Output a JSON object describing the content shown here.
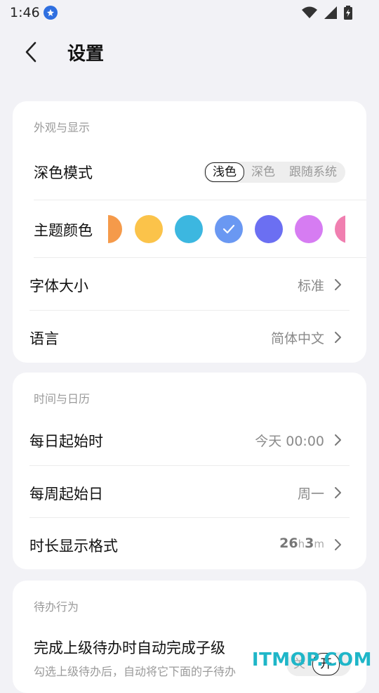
{
  "status": {
    "time": "1:46"
  },
  "header": {
    "title": "设置"
  },
  "appearance": {
    "section_title": "外观与显示",
    "dark_mode": {
      "label": "深色模式",
      "options": [
        "浅色",
        "深色",
        "跟随系统"
      ],
      "selected": "浅色"
    },
    "theme_color": {
      "label": "主题颜色",
      "swatches": [
        "#f59a4a",
        "#fbc34a",
        "#3cb7e0",
        "#6a98f2",
        "#6b6ff2",
        "#d67cf2",
        "#f07fb0"
      ],
      "selected_swatch": "#6a98f2"
    },
    "font_size": {
      "label": "字体大小",
      "value": "标准"
    },
    "language": {
      "label": "语言",
      "value": "简体中文"
    }
  },
  "time_calendar": {
    "section_title": "时间与日历",
    "day_start": {
      "label": "每日起始时",
      "value": "今天 00:00"
    },
    "week_start": {
      "label": "每周起始日",
      "value": "周一"
    },
    "duration_format": {
      "label": "时长显示格式",
      "value_parts": [
        "26",
        "h",
        "3",
        "m"
      ]
    }
  },
  "todo": {
    "section_title": "待办行为",
    "auto_complete": {
      "label": "完成上级待办时自动完成子级",
      "desc": "勾选上级待办后，自动将它下面的子待办",
      "options": [
        "关",
        "开"
      ],
      "selected": "开"
    }
  },
  "watermark": "ITMOP.COM"
}
